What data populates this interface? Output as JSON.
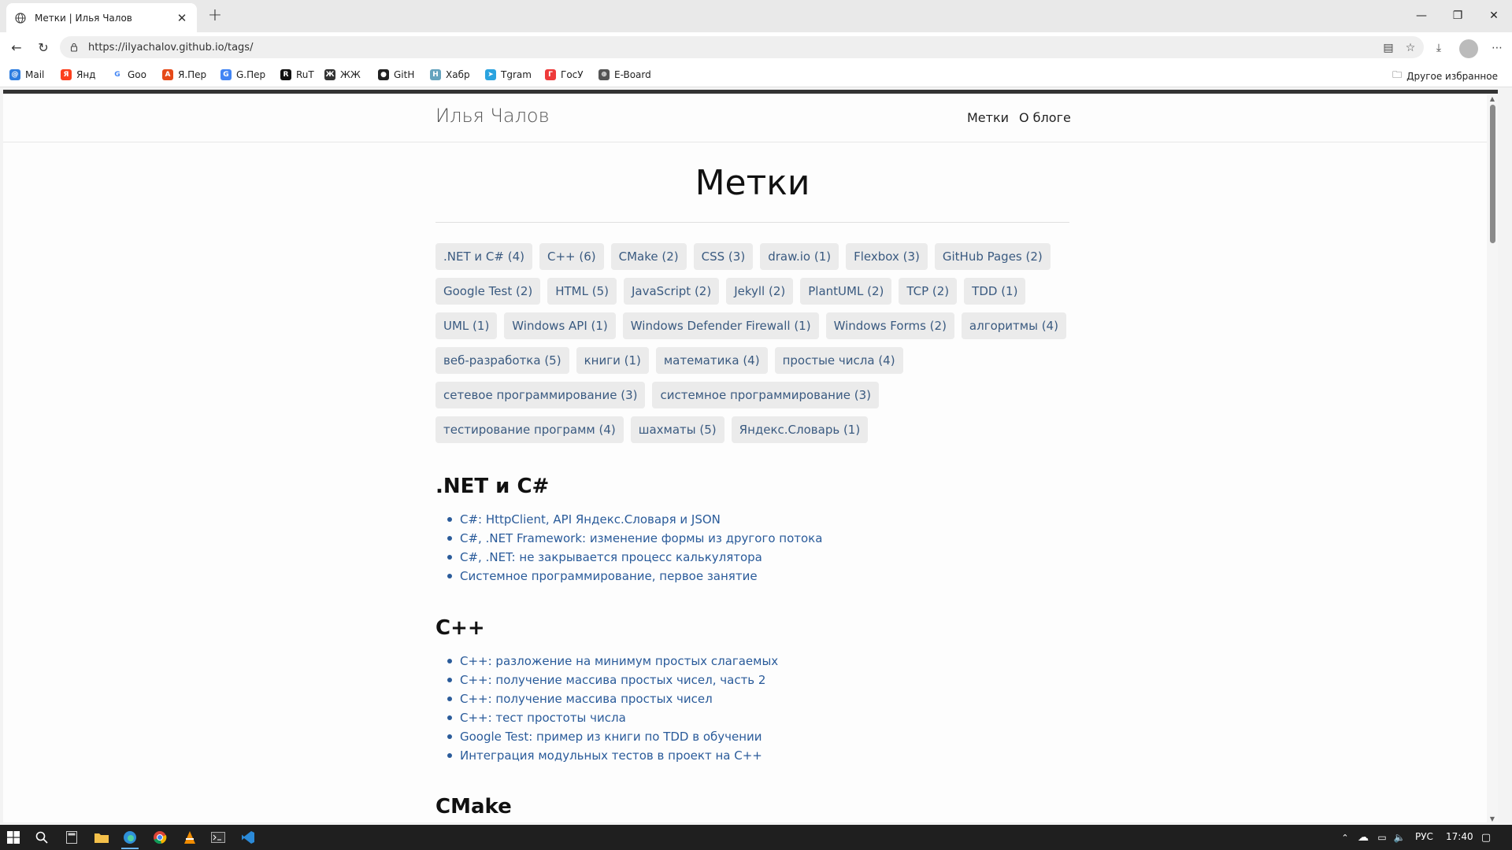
{
  "browser": {
    "tab_title": "Метки | Илья Чалов",
    "url": "https://ilyachalov.github.io/tags/",
    "bookmarks": [
      {
        "label": "Mail",
        "color": "#2d7de0",
        "glyph": "@"
      },
      {
        "label": "Янд",
        "color": "#fc3f1d",
        "glyph": "Я"
      },
      {
        "label": "Goo",
        "color": "#ffffff",
        "glyph": "G"
      },
      {
        "label": "Я.Пер",
        "color": "#e64a19",
        "glyph": "A"
      },
      {
        "label": "G.Пер",
        "color": "#4285f4",
        "glyph": "G"
      },
      {
        "label": "RuT",
        "color": "#111111",
        "glyph": "R"
      },
      {
        "label": "ЖЖ",
        "color": "#333333",
        "glyph": "Ж"
      },
      {
        "label": "GitH",
        "color": "#222222",
        "glyph": "●"
      },
      {
        "label": "Хабр",
        "color": "#65a3be",
        "glyph": "H"
      },
      {
        "label": "Tgram",
        "color": "#2aa3df",
        "glyph": "➤"
      },
      {
        "label": "ГосУ",
        "color": "#ee3a3a",
        "glyph": "Г"
      },
      {
        "label": "E-Board",
        "color": "#555555",
        "glyph": "⊕"
      }
    ],
    "other_bookmarks": "Другое избранное"
  },
  "site": {
    "title": "Илья Чалов",
    "nav": [
      "Метки",
      "О блоге"
    ]
  },
  "page": {
    "heading": "Метки",
    "tags": [
      ".NET и C# (4)",
      "C++ (6)",
      "CMake (2)",
      "CSS (3)",
      "draw.io (1)",
      "Flexbox (3)",
      "GitHub Pages (2)",
      "Google Test (2)",
      "HTML (5)",
      "JavaScript (2)",
      "Jekyll (2)",
      "PlantUML (2)",
      "TCP (2)",
      "TDD (1)",
      "UML (1)",
      "Windows API (1)",
      "Windows Defender Firewall (1)",
      "Windows Forms (2)",
      "алгоритмы (4)",
      "веб-разработка (5)",
      "книги (1)",
      "математика (4)",
      "простые числа (4)",
      "сетевое программирование (3)",
      "системное программирование (3)",
      "тестирование программ (4)",
      "шахматы (5)",
      "Яндекс.Словарь (1)"
    ],
    "sections": [
      {
        "title": ".NET и C#",
        "posts": [
          "C#: HttpClient, API Яндекс.Словаря и JSON",
          "C#, .NET Framework: изменение формы из другого потока",
          "C#, .NET: не закрывается процесс калькулятора",
          "Системное программирование, первое занятие"
        ]
      },
      {
        "title": "C++",
        "posts": [
          "C++: разложение на минимум простых слагаемых",
          "C++: получение массива простых чисел, часть 2",
          "C++: получение массива простых чисел",
          "C++: тест простоты числа",
          "Google Test: пример из книги по TDD в обучении",
          "Интеграция модульных тестов в проект на C++"
        ]
      },
      {
        "title": "CMake",
        "posts": []
      }
    ]
  },
  "taskbar": {
    "lang": "РУС",
    "time": "17:40"
  }
}
